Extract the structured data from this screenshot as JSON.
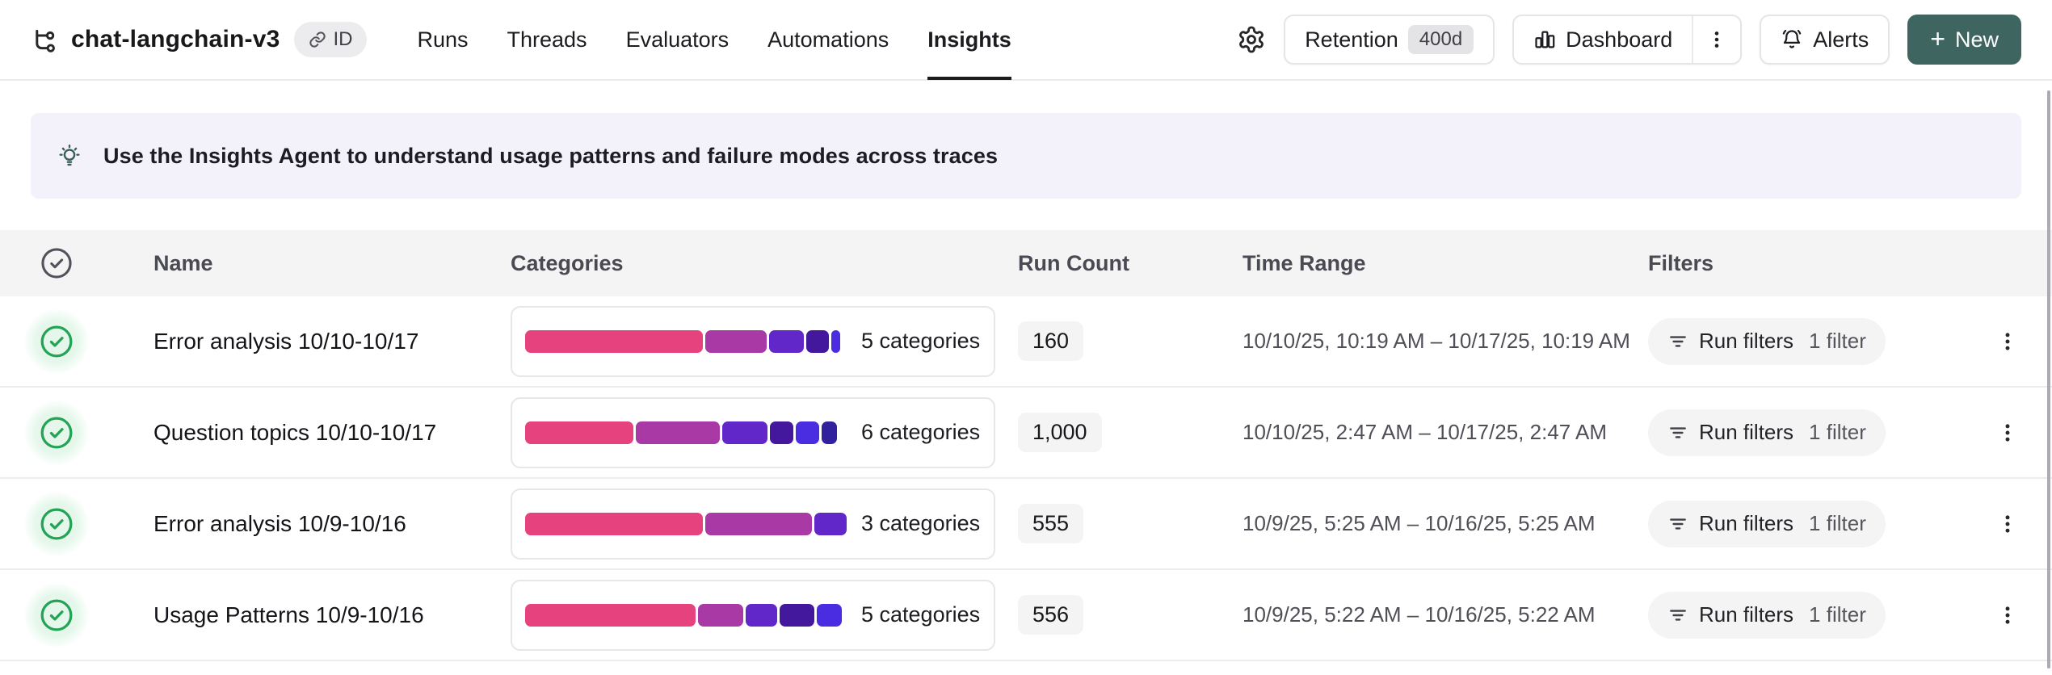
{
  "header": {
    "title": "chat-langchain-v3",
    "id_badge": "ID",
    "tabs": [
      {
        "label": "Runs",
        "active": false
      },
      {
        "label": "Threads",
        "active": false
      },
      {
        "label": "Evaluators",
        "active": false
      },
      {
        "label": "Automations",
        "active": false
      },
      {
        "label": "Insights",
        "active": true
      }
    ],
    "retention": {
      "label": "Retention",
      "value": "400d"
    },
    "dashboard_label": "Dashboard",
    "alerts_label": "Alerts",
    "new_button": {
      "plus": "+",
      "label": "New"
    }
  },
  "banner": {
    "text": "Use the Insights Agent to understand usage patterns and failure modes across traces"
  },
  "table": {
    "columns": {
      "name": "Name",
      "categories": "Categories",
      "run_count": "Run Count",
      "time_range": "Time Range",
      "filters": "Filters"
    },
    "rows": [
      {
        "name": "Error analysis 10/10-10/17",
        "categories_label": "5 categories",
        "segments": [
          {
            "color": "#e5427e",
            "pct": 56.5
          },
          {
            "color": "#a839a5",
            "pct": 19.5
          },
          {
            "color": "#6227c8",
            "pct": 11.0
          },
          {
            "color": "#44189c",
            "pct": 7.0
          },
          {
            "color": "#4a2de0",
            "pct": 3.0
          }
        ],
        "run_count": "160",
        "time_range": "10/10/25, 10:19 AM – 10/17/25, 10:19 AM",
        "filters": {
          "label": "Run filters",
          "count": "1 filter"
        }
      },
      {
        "name": "Question topics 10/10-10/17",
        "categories_label": "6 categories",
        "segments": [
          {
            "color": "#e5427e",
            "pct": 34.5
          },
          {
            "color": "#a839a5",
            "pct": 27.0
          },
          {
            "color": "#6227c8",
            "pct": 14.5
          },
          {
            "color": "#44189c",
            "pct": 7.5
          },
          {
            "color": "#4a2de0",
            "pct": 7.5
          },
          {
            "color": "#32219c",
            "pct": 5.0
          }
        ],
        "run_count": "1,000",
        "time_range": "10/10/25, 2:47 AM – 10/17/25, 2:47 AM",
        "filters": {
          "label": "Run filters",
          "count": "1 filter"
        }
      },
      {
        "name": "Error analysis 10/9-10/16",
        "categories_label": "3 categories",
        "segments": [
          {
            "color": "#e5427e",
            "pct": 55.5
          },
          {
            "color": "#a839a5",
            "pct": 33.5
          },
          {
            "color": "#6227c8",
            "pct": 10.0
          }
        ],
        "run_count": "555",
        "time_range": "10/9/25, 5:25 AM – 10/16/25, 5:25 AM",
        "filters": {
          "label": "Run filters",
          "count": "1 filter"
        }
      },
      {
        "name": "Usage Patterns 10/9-10/16",
        "categories_label": "5 categories",
        "segments": [
          {
            "color": "#e5427e",
            "pct": 54.0
          },
          {
            "color": "#a839a5",
            "pct": 14.5
          },
          {
            "color": "#6227c8",
            "pct": 10.0
          },
          {
            "color": "#44189c",
            "pct": 11.0
          },
          {
            "color": "#4a2de0",
            "pct": 8.0
          }
        ],
        "run_count": "556",
        "time_range": "10/9/25, 5:22 AM – 10/16/25, 5:22 AM",
        "filters": {
          "label": "Run filters",
          "count": "1 filter"
        }
      }
    ]
  },
  "colors": {
    "new_button_bg": "#3f6560",
    "banner_bg": "#f3f1fa",
    "success_green": "#23a455",
    "table_header_bg": "#f4f4f5"
  }
}
